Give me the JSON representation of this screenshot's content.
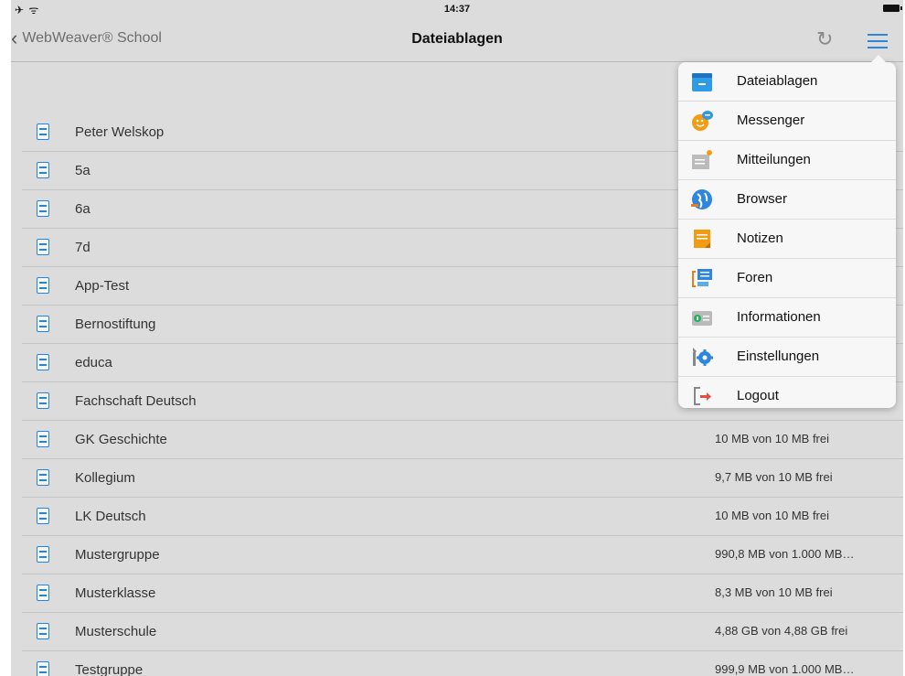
{
  "status": {
    "left": "✈ ᯤ",
    "time": "14:37"
  },
  "navbar": {
    "back_label": "WebWeaver® School",
    "title": "Dateiablagen",
    "refresh_icon": "refresh-icon",
    "menu_icon": "hamburger-menu-icon"
  },
  "colors": {
    "accent": "#2e86de",
    "background": "#dcdcdc",
    "menu_bg": "#f7f7f7"
  },
  "rows": [
    {
      "name": "Peter Welskop",
      "quota": ""
    },
    {
      "name": "5a",
      "quota": ""
    },
    {
      "name": "6a",
      "quota": ""
    },
    {
      "name": "7d",
      "quota": ""
    },
    {
      "name": "App-Test",
      "quota": ""
    },
    {
      "name": "Bernostiftung",
      "quota": ""
    },
    {
      "name": "educa",
      "quota": ""
    },
    {
      "name": "Fachschaft Deutsch",
      "quota": ""
    },
    {
      "name": "GK Geschichte",
      "quota": "10 MB von 10 MB frei"
    },
    {
      "name": "Kollegium",
      "quota": "9,7 MB von 10 MB frei"
    },
    {
      "name": "LK Deutsch",
      "quota": "10 MB von 10 MB frei"
    },
    {
      "name": "Mustergruppe",
      "quota": "990,8 MB von 1.000 MB…"
    },
    {
      "name": "Musterklasse",
      "quota": "8,3 MB von 10 MB frei"
    },
    {
      "name": "Musterschule",
      "quota": "4,88 GB von 4,88 GB frei"
    },
    {
      "name": "Testgruppe",
      "quota": "999,9 MB von 1.000 MB…"
    }
  ],
  "menu": [
    {
      "label": "Dateiablagen",
      "icon": "folder-icon"
    },
    {
      "label": "Messenger",
      "icon": "messenger-smiley-icon"
    },
    {
      "label": "Mitteilungen",
      "icon": "notification-icon"
    },
    {
      "label": "Browser",
      "icon": "globe-icon"
    },
    {
      "label": "Notizen",
      "icon": "note-icon"
    },
    {
      "label": "Foren",
      "icon": "forum-icon"
    },
    {
      "label": "Informationen",
      "icon": "info-icon"
    },
    {
      "label": "Einstellungen",
      "icon": "settings-gear-icon"
    },
    {
      "label": "Logout",
      "icon": "logout-icon"
    }
  ]
}
